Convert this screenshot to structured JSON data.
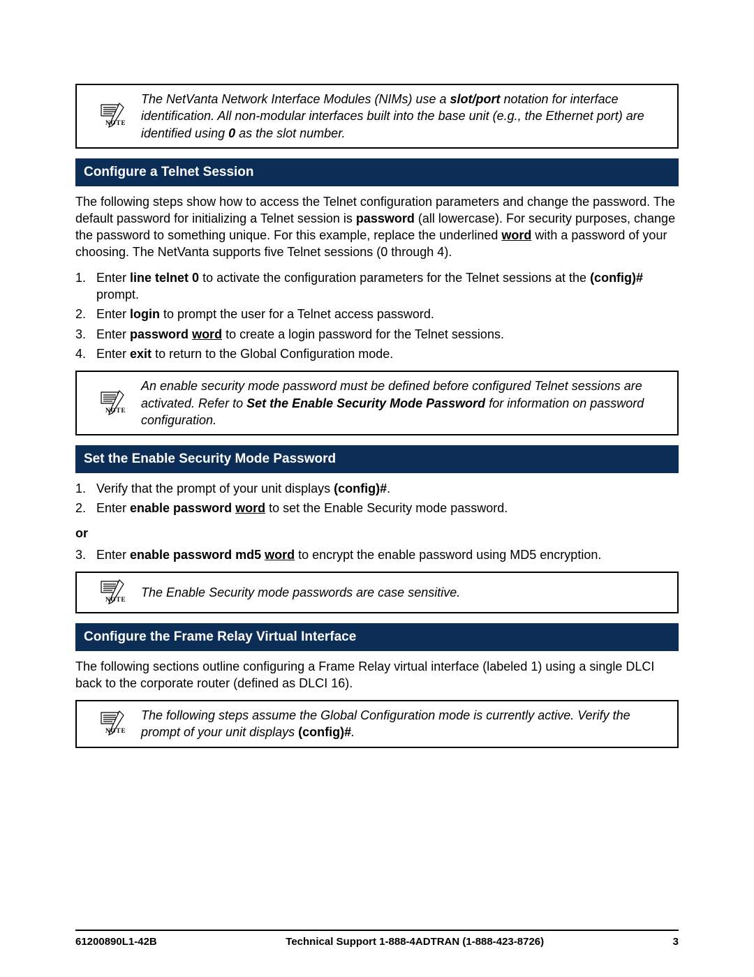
{
  "note1": {
    "pre": "The NetVanta Network Interface Modules (NIMs) use a ",
    "b1": "slot/port",
    "mid1": " notation for interface identification. All non-modular interfaces built into the base unit (e.g., the Ethernet port) are identified using ",
    "b2": "0",
    "post": " as the slot number."
  },
  "sec1": {
    "title": "Configure a Telnet Session",
    "intro_pre": "The following steps show how to access the Telnet configuration parameters and change the password. The default password for initializing a Telnet session is ",
    "intro_b1": "password",
    "intro_mid": " (all lowercase). For security purposes, change the password to something unique. For this example, replace the underlined ",
    "intro_u1": "word",
    "intro_post": " with a password of your choosing. The NetVanta supports five Telnet sessions (0 through 4).",
    "steps": [
      {
        "n": "1.",
        "pre": "Enter ",
        "b": "line telnet 0",
        "mid": " to activate the configuration parameters for the Telnet sessions at the ",
        "b2": "(config)#",
        "post": " prompt."
      },
      {
        "n": "2.",
        "pre": "Enter ",
        "b": "login",
        "post": " to prompt the user for a Telnet access password."
      },
      {
        "n": "3.",
        "pre": "Enter ",
        "b": "password ",
        "u": "word",
        "post": " to create a login password for the Telnet sessions."
      },
      {
        "n": "4.",
        "pre": "Enter ",
        "b": "exit",
        "post": " to return to the Global Configuration mode."
      }
    ]
  },
  "note2": {
    "pre": "An enable security mode password must be defined before configured Telnet sessions are activated. Refer to ",
    "b": "Set the Enable Security Mode Password",
    "post": " for information on password configuration."
  },
  "sec2": {
    "title": "Set the Enable Security Mode Password",
    "steps_a": [
      {
        "n": "1.",
        "pre": "Verify that the prompt of your unit displays ",
        "b": "(config)#",
        "post": "."
      },
      {
        "n": "2.",
        "pre": "Enter ",
        "b": "enable password ",
        "u": "word",
        "post": " to set the Enable Security mode password."
      }
    ],
    "or": "or",
    "steps_b": [
      {
        "n": "3.",
        "pre": "Enter ",
        "b": "enable password md5 ",
        "u": "word",
        "post": " to encrypt the enable password using MD5 encryption."
      }
    ]
  },
  "note3": {
    "text": "The Enable Security mode passwords are case sensitive."
  },
  "sec3": {
    "title": "Configure the Frame Relay Virtual Interface",
    "intro": "The following sections outline configuring a Frame Relay virtual interface (labeled 1) using a single DLCI back to the corporate router (defined as DLCI 16)."
  },
  "note4": {
    "pre": "The following steps assume the Global Configuration mode is currently active. Verify the prompt of your unit displays ",
    "b": "(config)#",
    "post": "."
  },
  "footer": {
    "left": "61200890L1-42B",
    "center": "Technical Support 1-888-4ADTRAN (1-888-423-8726)",
    "right": "3"
  }
}
